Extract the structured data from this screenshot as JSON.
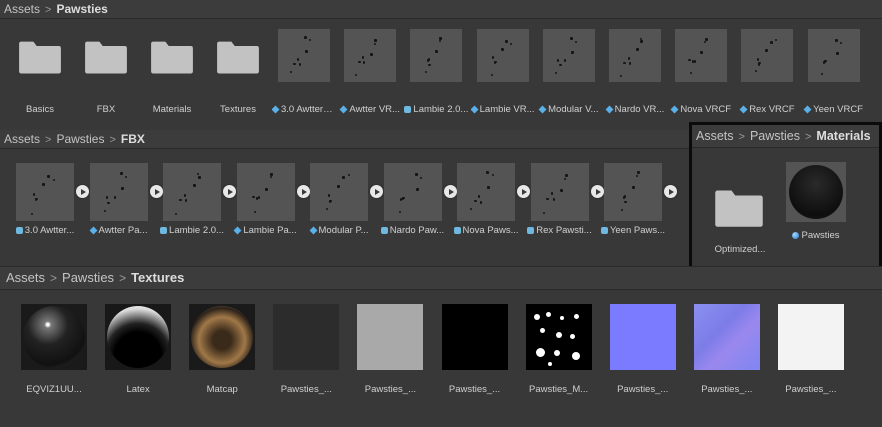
{
  "top": {
    "breadcrumb": [
      "Assets",
      "Pawsties"
    ],
    "folders": [
      "Basics",
      "FBX",
      "Materials",
      "Textures"
    ],
    "models": [
      "3.0 Awtter_...",
      "Awtter VR...",
      "Lambie 2.0...",
      "Lambie VR...",
      "Modular V...",
      "Nardo VR...",
      "Nova VRCF",
      "Rex VRCF",
      "Yeen VRCF"
    ],
    "model_icons": [
      "prefab",
      "prefab",
      "mesh",
      "prefab",
      "prefab",
      "prefab",
      "prefab",
      "prefab",
      "prefab"
    ]
  },
  "fbx": {
    "breadcrumb": [
      "Assets",
      "Pawsties",
      "FBX"
    ],
    "models": [
      "3.0 Awtter...",
      "Awtter Pa...",
      "Lambie 2.0...",
      "Lambie Pa...",
      "Modular P...",
      "Nardo Paw...",
      "Nova Paws...",
      "Rex Pawsti...",
      "Yeen Paws..."
    ],
    "model_icons": [
      "mesh",
      "prefab",
      "mesh",
      "prefab",
      "prefab",
      "mesh",
      "mesh",
      "mesh",
      "mesh"
    ]
  },
  "materials": {
    "breadcrumb": [
      "Assets",
      "Pawsties",
      "Materials"
    ],
    "folder": "Optimized...",
    "material": "Pawsties"
  },
  "textures": {
    "breadcrumb": [
      "Assets",
      "Pawsties",
      "Textures"
    ],
    "items": [
      {
        "label": "EQVIZ1UU...",
        "kind": "sphere-dark"
      },
      {
        "label": "Latex",
        "kind": "sphere-latex"
      },
      {
        "label": "Matcap",
        "kind": "sphere-matcap"
      },
      {
        "label": "Pawsties_...",
        "kind": "noise-dark"
      },
      {
        "label": "Pawsties_...",
        "kind": "noise-light"
      },
      {
        "label": "Pawsties_...",
        "kind": "black"
      },
      {
        "label": "Pawsties_M...",
        "kind": "mask"
      },
      {
        "label": "Pawsties_...",
        "kind": "blue"
      },
      {
        "label": "Pawsties_...",
        "kind": "normal"
      },
      {
        "label": "Pawsties_...",
        "kind": "white"
      }
    ]
  },
  "colors": {
    "background": "#383838",
    "model_thumb": "#545454",
    "folder": "#c2c2c2",
    "highlight_border": "#0b0b0b"
  }
}
